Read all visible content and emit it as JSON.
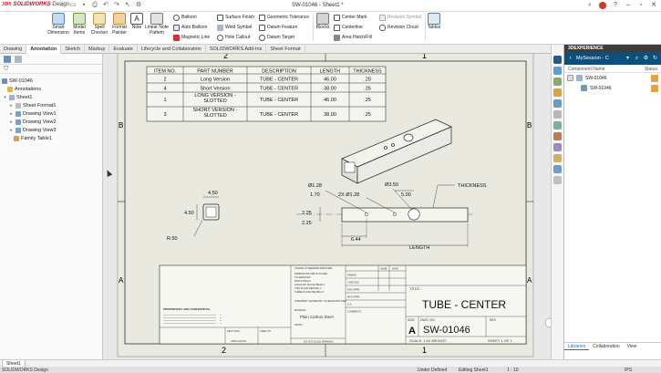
{
  "app": {
    "logo_mark": "3DS",
    "logo_text": "SOLIDWORKS",
    "logo_suffix": "Design",
    "title": "SW-01046 - Sheet1 *"
  },
  "ribbon": {
    "smart_dimension": "Smart Dimension",
    "model_items": "Model Items",
    "spell_checker": "Spell Checker",
    "format_painter": "Format Painter",
    "note": "Note",
    "linear_note_pattern": "Linear Note Pattern",
    "balloon": "Balloon",
    "auto_balloon": "Auto Balloon",
    "magnetic_line": "Magnetic Line",
    "surface_finish": "Surface Finish",
    "weld_symbol": "Weld Symbol",
    "hole_callout": "Hole Callout",
    "geometric_tolerance": "Geometric Tolerance",
    "datum_feature": "Datum Feature",
    "datum_target": "Datum Target",
    "blocks": "Blocks",
    "center_mark": "Center Mark",
    "centerline": "Centerline",
    "area_hatch_fill": "Area Hatch/Fill",
    "revision_symbol": "Revision Symbol",
    "revision_cloud": "Revision Cloud",
    "tables": "Tables"
  },
  "tabs": [
    "Drawing",
    "Annotation",
    "Sketch",
    "Markup",
    "Evaluate",
    "Lifecycle and Collaboration",
    "SOLIDWORKS Add-Ins",
    "Sheet Format"
  ],
  "active_tab": "Annotation",
  "tree": {
    "root": "SW-01046",
    "items": [
      "Annotations",
      "Sheet1",
      "Sheet Format1",
      "Drawing View1",
      "Drawing View2",
      "Drawing View3",
      "Family Table1"
    ]
  },
  "drawing": {
    "zone_top_left": "2",
    "zone_top_right": "1",
    "zone_bottom_left": "2",
    "zone_bottom_right": "1",
    "zone_b_left": "B",
    "zone_b_right": "B",
    "zone_a_left": "A",
    "zone_a_right": "A",
    "table_headers": [
      "ITEM NO.",
      "PART NUMBER",
      "DESCRIPTION",
      "LENGTH",
      "THICKNESS"
    ],
    "table_rows": [
      [
        "2",
        "Long Version",
        "TUBE - CENTER",
        "46.00",
        ".25"
      ],
      [
        "4",
        "Short Version",
        "TUBE - CENTER",
        "38.00",
        ".25"
      ],
      [
        "1",
        "LONG VERSION - SLOTTED",
        "TUBE - CENTER",
        "46.00",
        ".25"
      ],
      [
        "3",
        "SHORT VERSION - SLOTTED",
        "TUBE - CENTER",
        "38.00",
        ".25"
      ]
    ],
    "dims": {
      "end_width": "4.50",
      "end_height": "4.50",
      "radius": "R.50",
      "hole1": "Ø1.28",
      "hole_pattern": "2X Ø1.28",
      "hole_large": "Ø3.50",
      "d170": "1.70",
      "d225a": "2.25",
      "d225b": "2.25",
      "d500": "5.00",
      "d644": "6.44",
      "length": "LENGTH",
      "thickness": "THICKNESS"
    },
    "title_block": {
      "title_label": "TITLE:",
      "title": "TUBE - CENTER",
      "size_label": "SIZE",
      "dwg_label": "DWG. NO.",
      "rev_label": "REV",
      "size": "A",
      "dwg_no": "SW-01046",
      "scale": "SCALE: 1:10 WEIGHT:",
      "sheet": "SHEET 1 OF 1",
      "unless": "UNLESS OTHERWISE SPECIFIED:",
      "name": "NAME",
      "date": "DATE",
      "drawn": "DRAWN",
      "checked": "CHECKED",
      "eng_appr": "ENG APPR.",
      "mfg_appr": "MFG APPR.",
      "qa": "Q.A.",
      "comments": "COMMENTS:",
      "dims_note": "DIMENSIONS ARE IN INCHES",
      "tol_note": "TOLERANCES:",
      "frac_note": "FRACTIONAL±",
      "ang_note": "ANGULAR: MACH±  BEND ±",
      "two_place": "TWO PLACE DECIMAL  ±",
      "three_place": "THREE PLACE DECIMAL  ±",
      "interpret": "INTERPRET GEOMETRIC TOLERANCING PER:",
      "material_label": "MATERIAL",
      "material": "Plain Carbon Steel",
      "finish": "FINISH",
      "next_assy": "NEXT ASSY",
      "used_on": "USED ON",
      "application": "APPLICATION",
      "do_not_scale": "DO NOT SCALE DRAWING",
      "proprietary": "PROPRIETARY AND CONFIDENTIAL"
    }
  },
  "rightpanel": {
    "header": "3DEXPERIENCE",
    "session": "MySession - C",
    "col_name": "Component Name",
    "col_status": "Status",
    "row1": "SW-01046",
    "row2": "SW-01046",
    "bottom_tabs": [
      "Libraries",
      "Collaboration",
      "View"
    ]
  },
  "sheet_tab": "Sheet1",
  "status": {
    "app": "SOLIDWORKS Design",
    "defined": "Under Defined",
    "editing": "Editing Sheet1",
    "scale": "1 : 10",
    "units": "IPS"
  }
}
